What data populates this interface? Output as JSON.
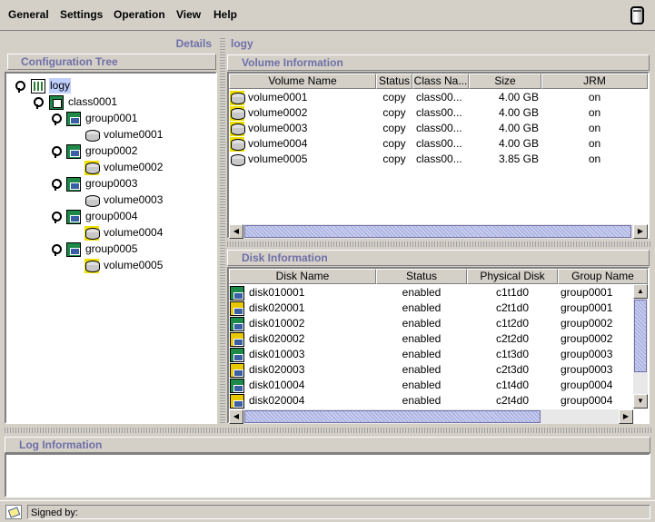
{
  "menu": {
    "items": [
      "General",
      "Settings",
      "Operation",
      "View",
      "Help"
    ],
    "trash_icon": "trash-can-icon"
  },
  "left": {
    "header": "Details",
    "tree_title": "Configuration Tree",
    "tree": {
      "root": "logy",
      "class": "class0001",
      "groups": [
        {
          "name": "group0001",
          "volume": "volume0001"
        },
        {
          "name": "group0002",
          "volume": "volume0002"
        },
        {
          "name": "group0003",
          "volume": "volume0003"
        },
        {
          "name": "group0004",
          "volume": "volume0004"
        },
        {
          "name": "group0005",
          "volume": "volume0005"
        }
      ]
    }
  },
  "right": {
    "header": "logy",
    "volume": {
      "title": "Volume Information",
      "columns": [
        "Volume Name",
        "Status",
        "Class Na...",
        "Size",
        "JRM"
      ],
      "rows": [
        [
          "volume0001",
          "copy",
          "class00...",
          "4.00 GB",
          "on"
        ],
        [
          "volume0002",
          "copy",
          "class00...",
          "4.00 GB",
          "on"
        ],
        [
          "volume0003",
          "copy",
          "class00...",
          "4.00 GB",
          "on"
        ],
        [
          "volume0004",
          "copy",
          "class00...",
          "4.00 GB",
          "on"
        ],
        [
          "volume0005",
          "copy",
          "class00...",
          "3.85 GB",
          "on"
        ]
      ]
    },
    "disk": {
      "title": "Disk Information",
      "columns": [
        "Disk Name",
        "Status",
        "Physical Disk",
        "Group Name"
      ],
      "rows": [
        [
          "disk010001",
          "enabled",
          "c1t1d0",
          "group0001"
        ],
        [
          "disk020001",
          "enabled",
          "c2t1d0",
          "group0001"
        ],
        [
          "disk010002",
          "enabled",
          "c1t2d0",
          "group0002"
        ],
        [
          "disk020002",
          "enabled",
          "c2t2d0",
          "group0002"
        ],
        [
          "disk010003",
          "enabled",
          "c1t3d0",
          "group0003"
        ],
        [
          "disk020003",
          "enabled",
          "c2t3d0",
          "group0003"
        ],
        [
          "disk010004",
          "enabled",
          "c1t4d0",
          "group0004"
        ],
        [
          "disk020004",
          "enabled",
          "c2t4d0",
          "group0004"
        ]
      ]
    }
  },
  "log": {
    "title": "Log Information"
  },
  "status_bar": {
    "text": "Signed by:"
  },
  "colors": {
    "title_text": "#6f6fa8",
    "background": "#d4d0c8",
    "scroll_thumb": "#9fa8d8"
  }
}
